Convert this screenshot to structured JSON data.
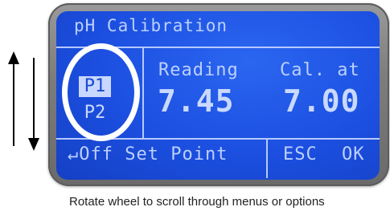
{
  "display": {
    "title": "pH Calibration",
    "presets": [
      {
        "label": "P1",
        "selected": true
      },
      {
        "label": "P2",
        "selected": false
      }
    ],
    "reading_label": "Reading",
    "reading_value": "7.45",
    "cal_label": "Cal. at",
    "cal_value": "7.00",
    "footer_left": "↵Off Set Point",
    "footer_esc": "ESC",
    "footer_ok": "OK"
  },
  "caption": "Rotate wheel to scroll through menus or options",
  "colors": {
    "lcd_background": "#1c4fe0",
    "lcd_text": "#c9d9ff",
    "highlight_circle": "#ffffff"
  }
}
